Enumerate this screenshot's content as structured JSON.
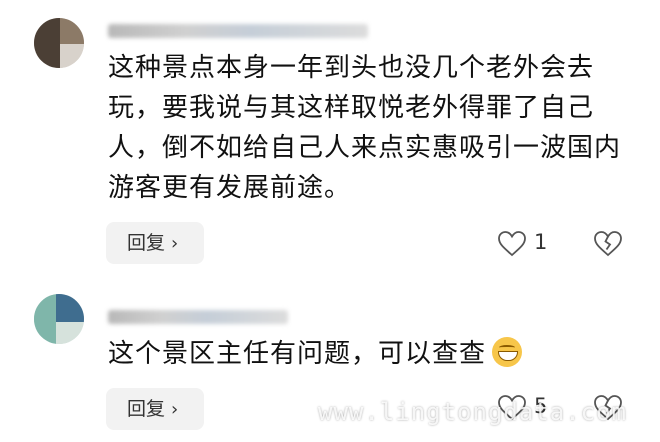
{
  "comments": [
    {
      "text": "这种景点本身一年到头也没几个老外会去玩，要我说与其这样取悦老外得罪了自己人，倒不如给自己人来点实惠吸引一波国内游客更有发展前途。",
      "reply_label": "回复",
      "likes": "1"
    },
    {
      "text": "这个景区主任有问题，可以查查",
      "reply_label": "回复",
      "likes": "5"
    }
  ],
  "icons": {
    "like": "heart-outline-icon",
    "dislike": "broken-heart-icon",
    "reply_arrow": "chevron-right-icon",
    "emoji": "grinning-face-emoji"
  },
  "watermark": "www.lingtongdata.com"
}
